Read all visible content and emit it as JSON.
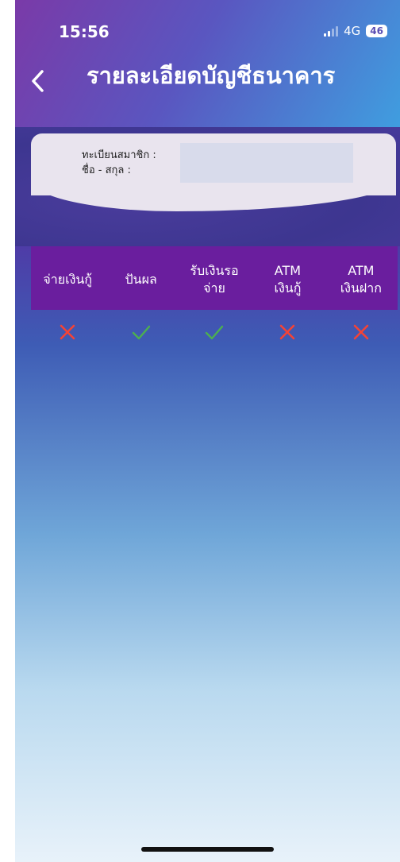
{
  "status_bar": {
    "time": "15:56",
    "network": "4G",
    "battery": "46"
  },
  "header": {
    "title": "รายละเอียดบัญชีธนาคาร",
    "back_icon": "chevron-left-icon"
  },
  "member_card": {
    "member_id_label": "ทะเบียนสมาชิก :",
    "name_label": "ชื่อ - สกุล :"
  },
  "table": {
    "columns": [
      {
        "line1": "จ่ายเงินกู้",
        "line2": ""
      },
      {
        "line1": "ปันผล",
        "line2": ""
      },
      {
        "line1": "รับเงินรอ",
        "line2": "จ่าย"
      },
      {
        "line1": "ATM",
        "line2": "เงินกู้"
      },
      {
        "line1": "ATM",
        "line2": "เงินฝาก"
      }
    ],
    "row": [
      "cross",
      "check",
      "check",
      "cross",
      "cross"
    ]
  },
  "colors": {
    "table_header": "#6a1e9e",
    "check": "#4caf50",
    "cross": "#f44336"
  }
}
